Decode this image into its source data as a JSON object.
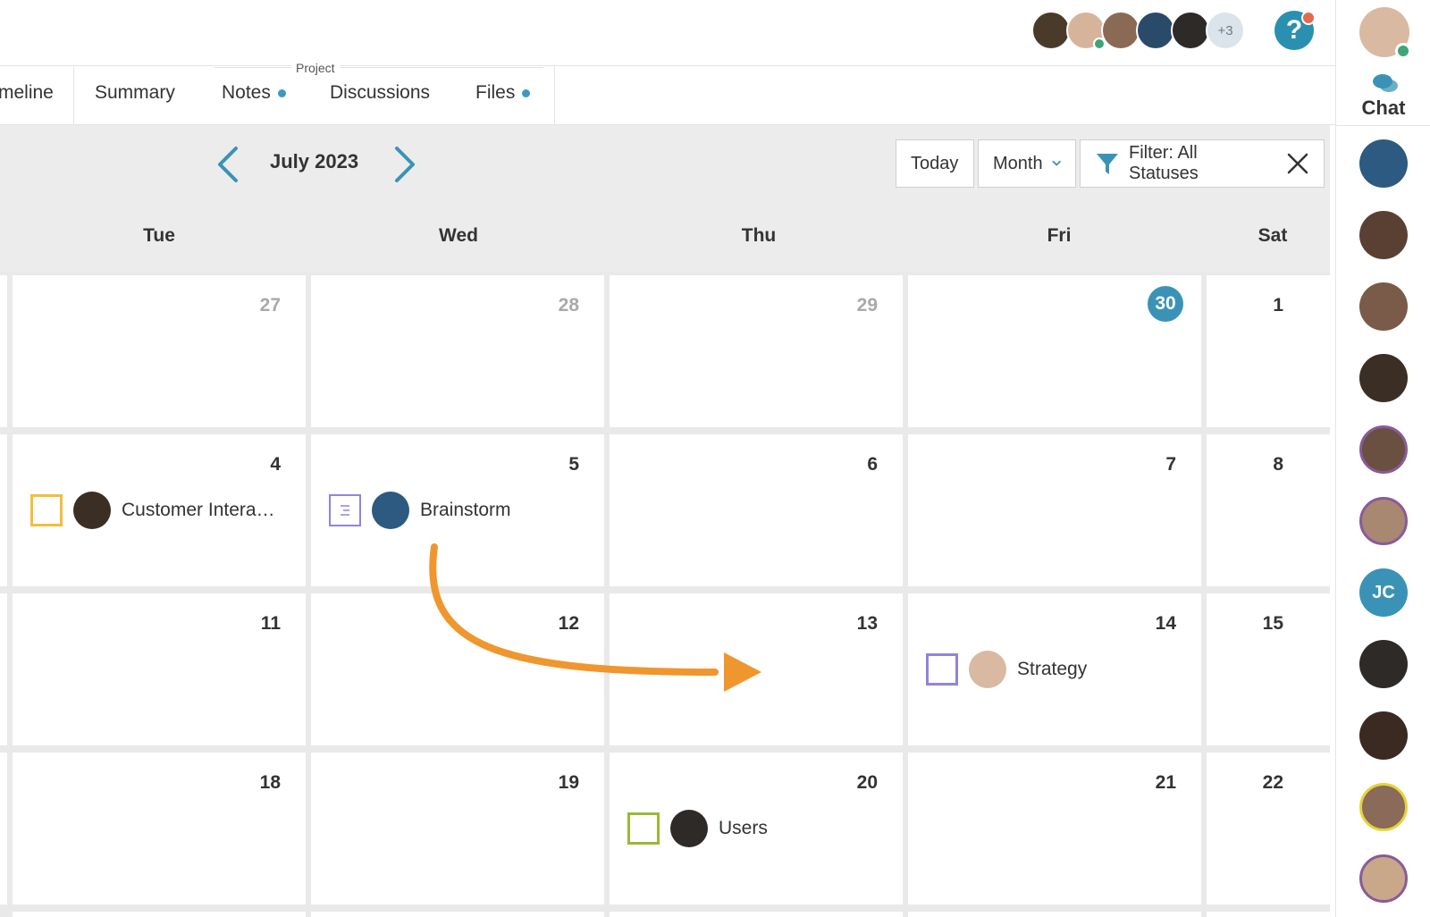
{
  "header": {
    "collaborators_more": "+3",
    "help_glyph": "?"
  },
  "tabs": {
    "section_label": "Project",
    "items": [
      {
        "label": "meline",
        "dot": false
      },
      {
        "label": "Summary",
        "dot": false
      },
      {
        "label": "Notes",
        "dot": true
      },
      {
        "label": "Discussions",
        "dot": false
      },
      {
        "label": "Files",
        "dot": true
      }
    ]
  },
  "calendar": {
    "title": "July 2023",
    "today_label": "Today",
    "view_label": "Month",
    "filter_label": "Filter: All Statuses",
    "weekdays": [
      "Tue",
      "Wed",
      "Thu",
      "Fri",
      "Sat"
    ],
    "weeks": [
      [
        "27",
        "28",
        "29",
        "30",
        "1"
      ],
      [
        "4",
        "5",
        "6",
        "7",
        "8"
      ],
      [
        "11",
        "12",
        "13",
        "14",
        "15"
      ],
      [
        "18",
        "19",
        "20",
        "21",
        "22"
      ]
    ],
    "events": {
      "customer": "Customer Intera…",
      "brainstorm": "Brainstorm",
      "strategy": "Strategy",
      "users": "Users"
    }
  },
  "rail": {
    "chat_label": "Chat",
    "jc_initials": "JC"
  },
  "colors": {
    "accent": "#3a93b6",
    "arrow": "#f0962e",
    "yellow_task": "#f2bf3a",
    "purple_task": "#8f84e0",
    "green_task": "#9bb834"
  }
}
